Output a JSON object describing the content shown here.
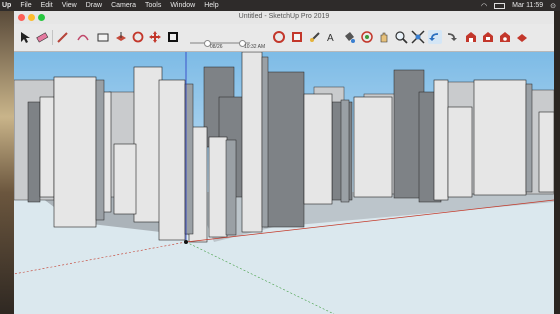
{
  "menubar": {
    "app": "Up",
    "items": [
      "File",
      "Edit",
      "View",
      "Draw",
      "Camera",
      "Tools",
      "Window",
      "Help"
    ],
    "clock": "Mar 11:59"
  },
  "window": {
    "title": "Untitled - SketchUp Pro 2019"
  },
  "toolbar": {
    "shadow_date": "08/26",
    "shadow_time": "10:32 AM",
    "icons": [
      "select-icon",
      "eraser-icon",
      "pencil-icon",
      "arc-icon",
      "rectangle-icon",
      "push-pull-icon",
      "rotate-icon",
      "move-icon",
      "offset-icon",
      "materials-icon",
      "orbit-icon",
      "pan-icon",
      "zoom-icon",
      "zoom-extents-icon",
      "previous-icon",
      "next-icon",
      "warehouse-icon",
      "extension-icon"
    ]
  },
  "colors": {
    "sky_top": "#7dbbe6",
    "ground": "#dbe8ee",
    "building_light": "#e6e6e6",
    "building_dark": "#7e8286",
    "red_axis": "#c43a2a",
    "green_axis": "#3a9a3a",
    "blue_axis": "#2a3ac4"
  }
}
